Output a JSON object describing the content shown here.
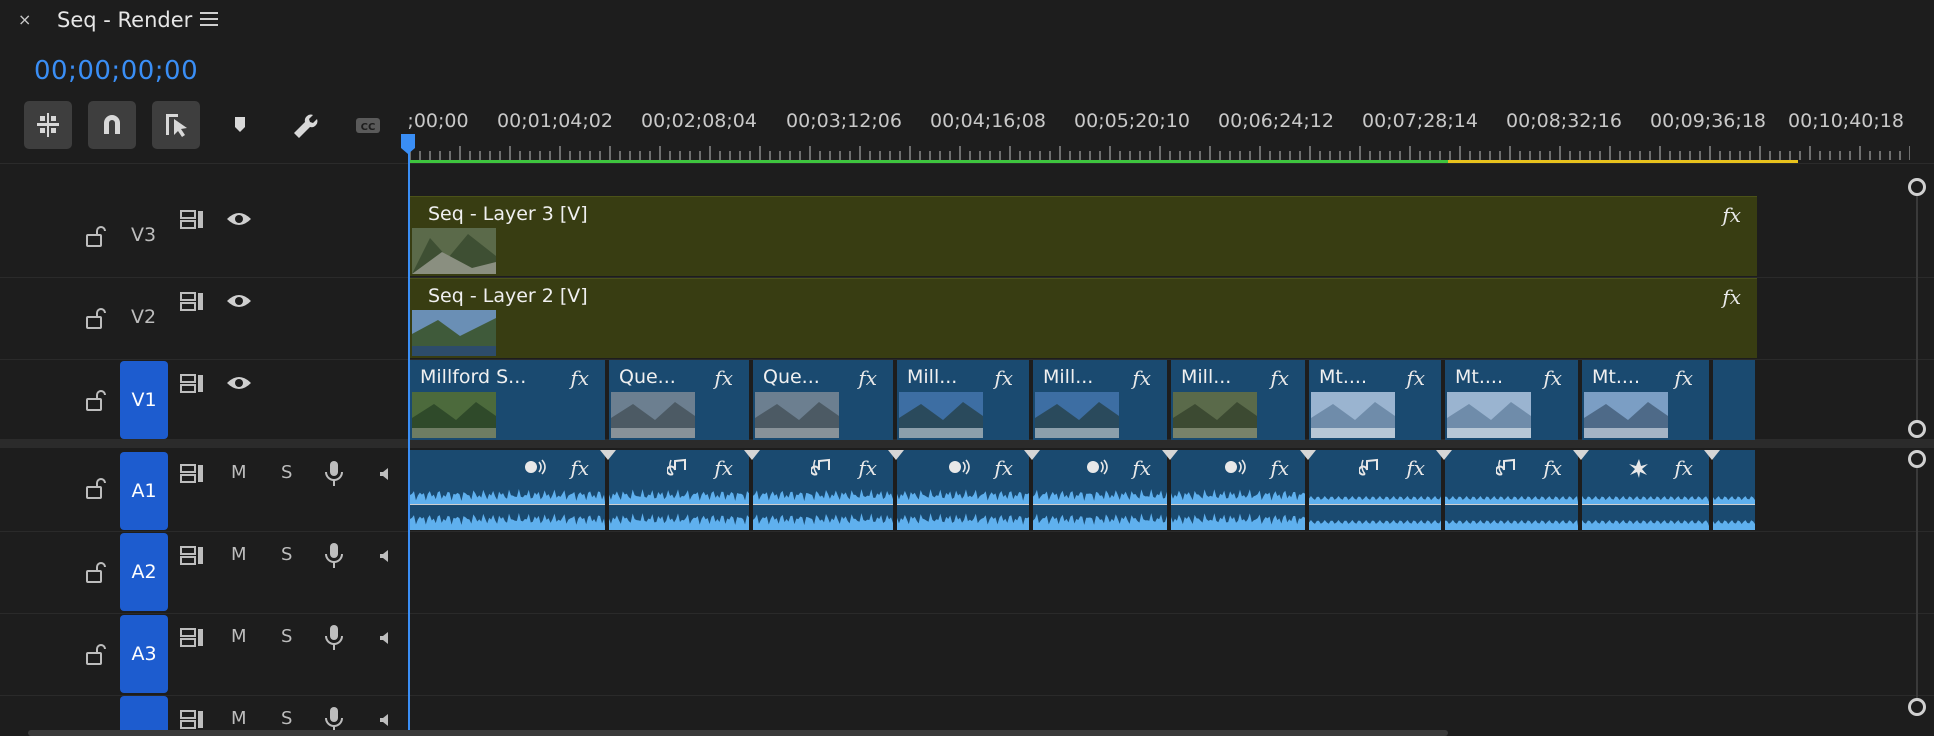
{
  "panel": {
    "close": "×",
    "title": "Seq - Render"
  },
  "timecode": "00;00;00;00",
  "ruler": {
    "labels": [
      ";00;00",
      "00;01;04;02",
      "00;02;08;04",
      "00;03;12;06",
      "00;04;16;08",
      "00;05;20;10",
      "00;06;24;12",
      "00;07;28;14",
      "00;08;32;16",
      "00;09;36;18",
      "00;10;40;18"
    ]
  },
  "tracks": {
    "v3": {
      "label": "V3"
    },
    "v2": {
      "label": "V2"
    },
    "v1": {
      "label": "V1"
    },
    "a1": {
      "label": "A1",
      "m": "M",
      "s": "S"
    },
    "a2": {
      "label": "A2",
      "m": "M",
      "s": "S"
    },
    "a3": {
      "label": "A3",
      "m": "M",
      "s": "S"
    },
    "a4": {
      "m": "M",
      "s": "S"
    }
  },
  "clips": {
    "v3": "Seq - Layer 3 [V]",
    "v2": "Seq - Layer 2 [V]",
    "v1": [
      "Millford S...",
      "Que...",
      "Que...",
      "Mill...",
      "Mill...",
      "Mill...",
      "Mt....",
      "Mt....",
      "Mt...."
    ],
    "fx": "fx"
  },
  "colors": {
    "accent": "#3a8ef5",
    "target": "#1d5ccf",
    "video_nested": "#383d12",
    "clip_blue": "#1a4a70",
    "render_green": "#3ec43e",
    "render_yellow": "#e8c21c"
  }
}
